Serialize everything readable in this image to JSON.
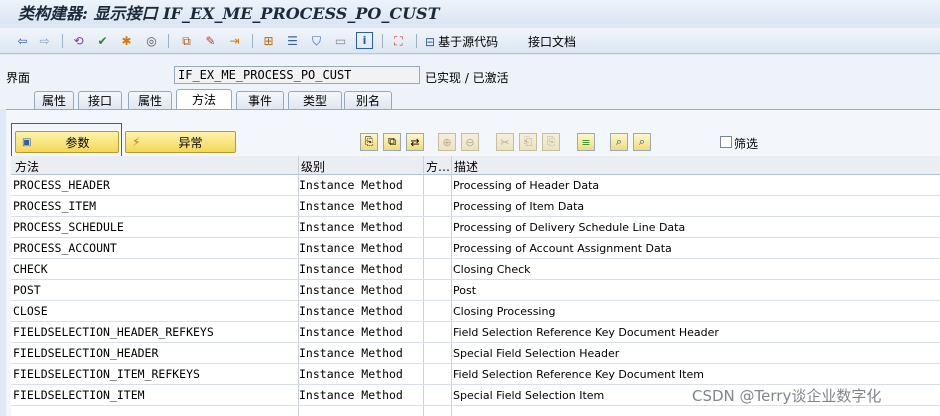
{
  "window_title": "类构建器: 显示接口 IF_EX_ME_PROCESS_PO_CUST",
  "toolbar": {
    "icons": [
      "back-arrow-icon",
      "forward-arrow-icon",
      "toggle-icon",
      "check-icon",
      "activate-icon",
      "test-icon",
      "where-used-icon",
      "pencil-icon",
      "export-icon",
      "hierarchy-icon",
      "list-icon",
      "filter-icon",
      "window-icon",
      "info-icon",
      "enhance-icon"
    ],
    "source_code_label": "基于源代码",
    "docs_label": "接口文档"
  },
  "interface": {
    "label": "界面",
    "name": "IF_EX_ME_PROCESS_PO_CUST",
    "status": "已实现 / 已激活"
  },
  "tabs": [
    {
      "label": "属性",
      "active": false
    },
    {
      "label": "接口",
      "active": false
    },
    {
      "label": "属性",
      "active": false
    },
    {
      "label": "方法",
      "active": true
    },
    {
      "label": "事件",
      "active": false
    },
    {
      "label": "类型",
      "active": false
    },
    {
      "label": "别名",
      "active": false
    }
  ],
  "buttons": {
    "params": "参数",
    "exceptions": "异常"
  },
  "filter_label": "筛选",
  "grid": {
    "headers": {
      "method": "方法",
      "level": "级别",
      "visibility": "方…",
      "description": "描述"
    },
    "rows": [
      {
        "method": "PROCESS_HEADER",
        "level": "Instance Method",
        "desc": "Processing of Header Data"
      },
      {
        "method": "PROCESS_ITEM",
        "level": "Instance Method",
        "desc": "Processing of Item Data"
      },
      {
        "method": "PROCESS_SCHEDULE",
        "level": "Instance Method",
        "desc": "Processing of Delivery Schedule Line Data"
      },
      {
        "method": "PROCESS_ACCOUNT",
        "level": "Instance Method",
        "desc": "Processing of Account Assignment Data"
      },
      {
        "method": "CHECK",
        "level": "Instance Method",
        "desc": "Closing Check"
      },
      {
        "method": "POST",
        "level": "Instance Method",
        "desc": "Post"
      },
      {
        "method": "CLOSE",
        "level": "Instance Method",
        "desc": "Closing Processing"
      },
      {
        "method": "FIELDSELECTION_HEADER_REFKEYS",
        "level": "Instance Method",
        "desc": "Field Selection Reference Key Document Header"
      },
      {
        "method": "FIELDSELECTION_HEADER",
        "level": "Instance Method",
        "desc": "Special Field Selection Header"
      },
      {
        "method": "FIELDSELECTION_ITEM_REFKEYS",
        "level": "Instance Method",
        "desc": "Field Selection Reference Key Document Item"
      },
      {
        "method": "FIELDSELECTION_ITEM",
        "level": "Instance Method",
        "desc": "Special Field Selection Item"
      }
    ]
  },
  "watermark": "CSDN @Terry谈企业数字化"
}
